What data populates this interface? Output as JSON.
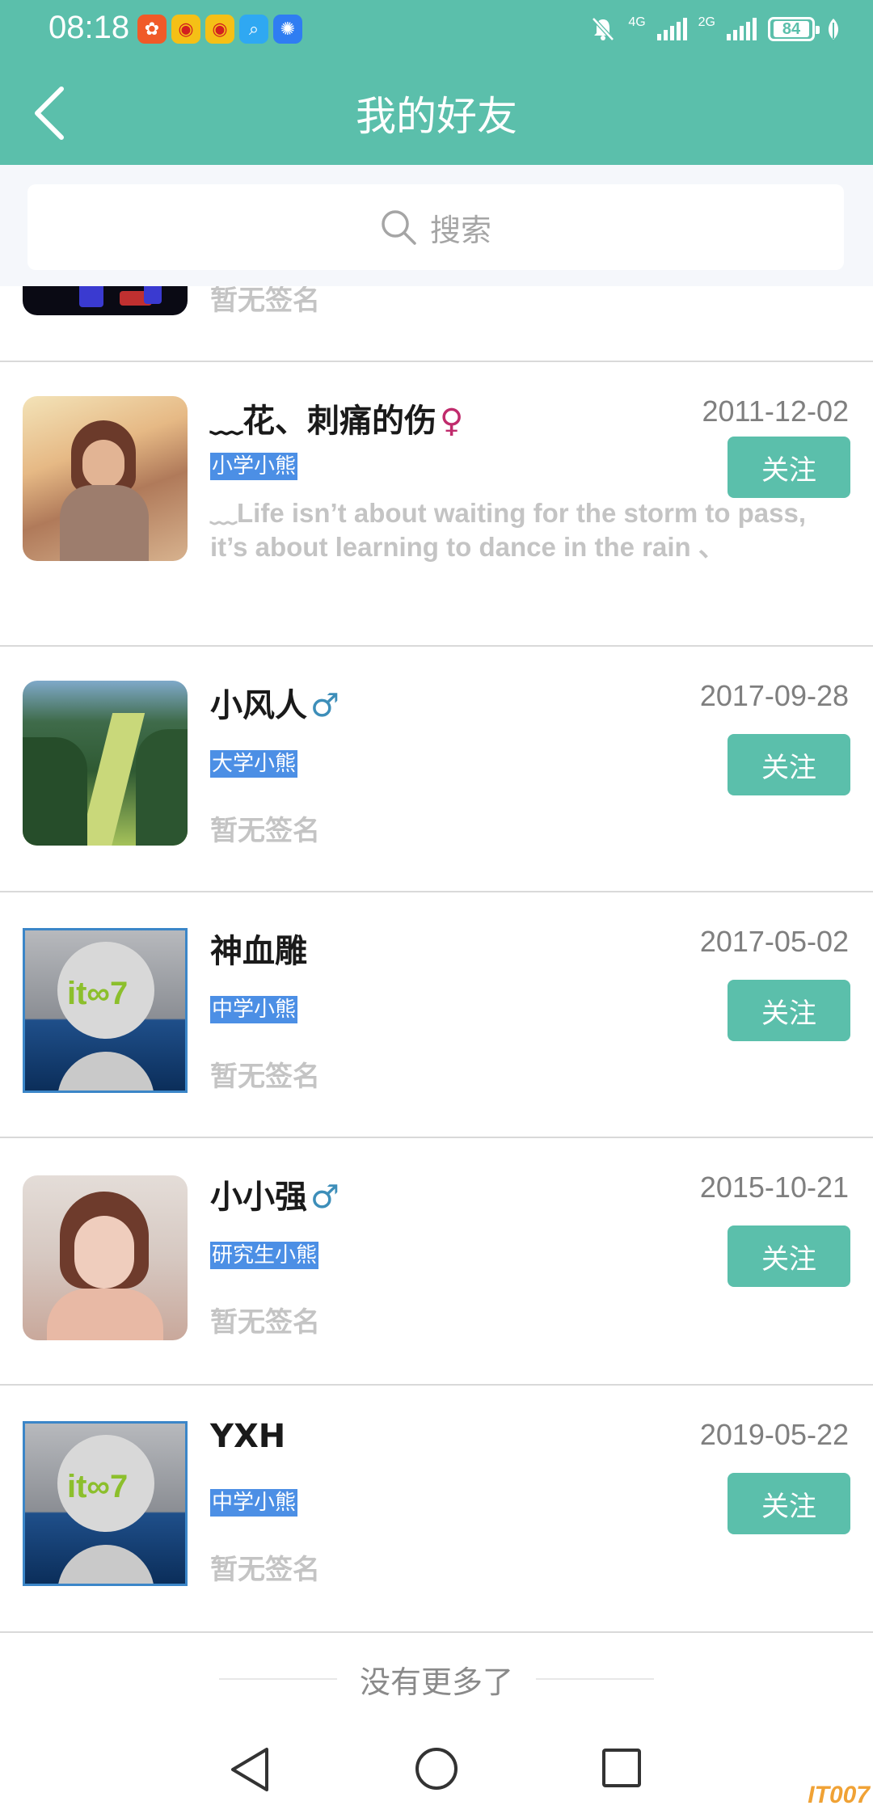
{
  "status_bar": {
    "time": "08:18",
    "network_1": "4G",
    "network_2": "2G",
    "battery": "84"
  },
  "header": {
    "title": "我的好友",
    "back_icon": "chevron-left-icon"
  },
  "search": {
    "placeholder": "搜索",
    "icon": "search-icon"
  },
  "partial_row": {
    "signature": "暂无签名"
  },
  "friends": [
    {
      "name": "﹏花、刺痛的伤",
      "gender": "♀",
      "date": "2011-12-02",
      "tag": "小学小熊",
      "signature": "﹏Life isn’t about waiting for the storm to pass, it’s about learning to dance in the rain 、",
      "follow_label": "关注"
    },
    {
      "name": "小风人",
      "gender": "♂",
      "date": "2017-09-28",
      "tag": "大学小熊",
      "signature": "暂无签名",
      "follow_label": "关注"
    },
    {
      "name": "神血雕",
      "gender": "",
      "date": "2017-05-02",
      "tag": "中学小熊",
      "signature": "暂无签名",
      "follow_label": "关注"
    },
    {
      "name": "小小强",
      "gender": "♂",
      "date": "2015-10-21",
      "tag": "研究生小熊",
      "signature": "暂无签名",
      "follow_label": "关注"
    },
    {
      "name": "YXH",
      "gender": "",
      "date": "2019-05-22",
      "tag": "中学小熊",
      "signature": "暂无签名",
      "follow_label": "关注"
    }
  ],
  "footer": {
    "end_text": "没有更多了"
  },
  "watermark": "IT007",
  "colors": {
    "accent": "#5bbfab",
    "tag_bg": "#4c8fe5",
    "female": "#c02b6c",
    "male": "#3d8eb9"
  }
}
